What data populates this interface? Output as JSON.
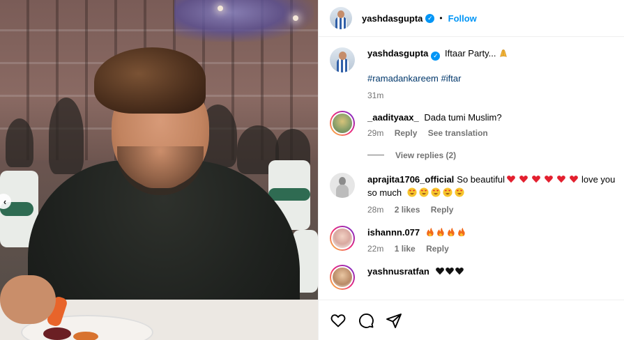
{
  "post": {
    "author": "yashdasgupta",
    "follow_label": "Follow",
    "dot": "•",
    "caption_text": "Iftaar Party...",
    "hashtags": "#ramadankareem #iftar",
    "caption_time": "31m"
  },
  "comments": [
    {
      "user": "_aadityaax_",
      "text": "Dada tumi Muslim?",
      "time": "29m",
      "reply_label": "Reply",
      "translation_label": "See translation",
      "view_replies": "View replies (2)"
    },
    {
      "user": "aprajita1706_official",
      "text_start": "So beautiful",
      "text_mid": "love you",
      "text_end": "so much",
      "time": "28m",
      "likes": "2 likes",
      "reply_label": "Reply"
    },
    {
      "user": "ishannn.077",
      "time": "22m",
      "likes": "1 like",
      "reply_label": "Reply"
    },
    {
      "user": "yashnusratfan"
    }
  ],
  "icons": [
    "verified-badge-icon",
    "heart-icon",
    "comment-icon",
    "share-icon",
    "chevron-left-icon"
  ],
  "colors": {
    "accent": "#0095f6",
    "hashtag": "#00376b",
    "muted": "#737373"
  }
}
